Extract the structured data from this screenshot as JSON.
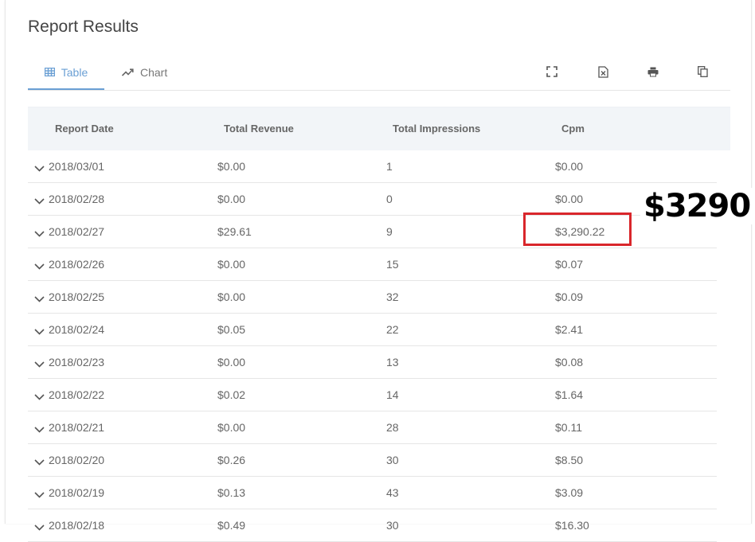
{
  "title": "Report Results",
  "tabs": [
    {
      "label": "Table",
      "icon": "grid-icon",
      "active": true
    },
    {
      "label": "Chart",
      "icon": "trend-icon",
      "active": false
    }
  ],
  "toolbar": [
    "fullscreen-icon",
    "excel-export-icon",
    "print-icon",
    "copy-icon"
  ],
  "colors": {
    "accent": "#6a9fd4",
    "highlight": "#d9262b",
    "header_bg": "#f2f5f8"
  },
  "table": {
    "headers": [
      "Report Date",
      "Total Revenue",
      "Total Impressions",
      "Cpm"
    ],
    "rows": [
      [
        "2018/03/01",
        "$0.00",
        "1",
        "$0.00"
      ],
      [
        "2018/02/28",
        "$0.00",
        "0",
        "$0.00"
      ],
      [
        "2018/02/27",
        "$29.61",
        "9",
        "$3,290.22"
      ],
      [
        "2018/02/26",
        "$0.00",
        "15",
        "$0.07"
      ],
      [
        "2018/02/25",
        "$0.00",
        "32",
        "$0.09"
      ],
      [
        "2018/02/24",
        "$0.05",
        "22",
        "$2.41"
      ],
      [
        "2018/02/23",
        "$0.00",
        "13",
        "$0.08"
      ],
      [
        "2018/02/22",
        "$0.02",
        "14",
        "$1.64"
      ],
      [
        "2018/02/21",
        "$0.00",
        "28",
        "$0.11"
      ],
      [
        "2018/02/20",
        "$0.26",
        "30",
        "$8.50"
      ],
      [
        "2018/02/19",
        "$0.13",
        "43",
        "$3.09"
      ],
      [
        "2018/02/18",
        "$0.49",
        "30",
        "$16.30"
      ]
    ]
  },
  "annotation": "$3290"
}
